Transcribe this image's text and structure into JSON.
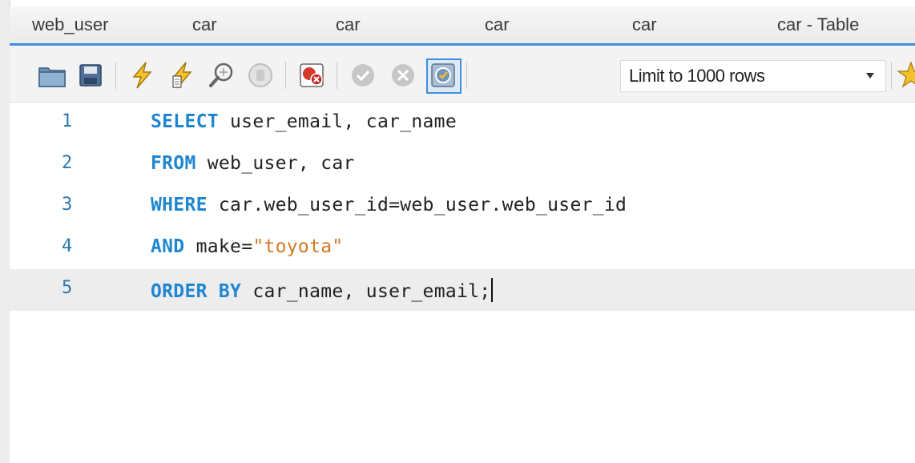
{
  "tabs": [
    {
      "label": "web_user"
    },
    {
      "label": "car"
    },
    {
      "label": "car"
    },
    {
      "label": "car"
    },
    {
      "label": "car"
    },
    {
      "label": "car - Table"
    }
  ],
  "toolbar": {
    "icons": [
      "open-folder-icon",
      "save-icon",
      "execute-icon",
      "execute-current-icon",
      "explain-icon",
      "stop-icon",
      "toggle-error-stop-icon",
      "commit-icon",
      "rollback-icon",
      "autocommit-icon",
      "beautify-icon"
    ],
    "limit_label": "Limit to 1000 rows"
  },
  "editor": {
    "lines": [
      {
        "num": "1",
        "kw1": "SELECT",
        "rest": " user_email, car_name"
      },
      {
        "num": "2",
        "kw1": "FROM",
        "rest": " web_user, car"
      },
      {
        "num": "3",
        "kw1": "WHERE",
        "rest": " car.web_user_id=web_user.web_user_id"
      },
      {
        "num": "4",
        "kw1": "AND",
        "rest_a": " make=",
        "string": "\"toyota\""
      },
      {
        "num": "5",
        "kw1": "ORDER BY",
        "rest": " car_name, user_email;"
      }
    ],
    "current_line": 5
  },
  "colors": {
    "keyword": "#1f86d0",
    "string": "#d07a28",
    "line_number": "#2a7ab0",
    "tab_underline": "#3f8fe0"
  }
}
